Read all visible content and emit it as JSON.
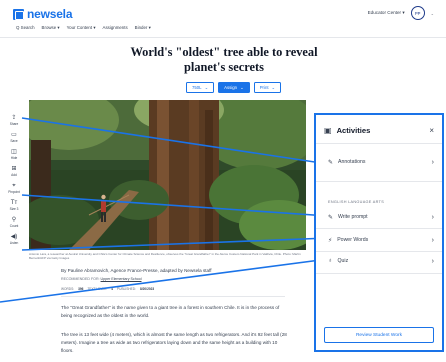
{
  "header": {
    "logo": "newsela",
    "nav": [
      "Q Search",
      "Browse ▾",
      "Your Content ▾",
      "Assignments",
      "Binder ▾"
    ],
    "user": {
      "label": "Educator Center ▾",
      "avatar_initials": "PP"
    }
  },
  "article": {
    "title": "World's \"oldest\" tree able to reveal planet's secrets",
    "controls": {
      "lexile": "750L",
      "assign": "Assign",
      "print": "Print"
    },
    "caption": "Antonio Lara, a researcher at Austral University and Chile's Center for Climate Science and Resilience, observes the \"Great Grandfather\" in the Alerce Costero National Park in Valdivia, Chile. Photo: Martin Bernetti/AFP via Getty Images",
    "byline": "By Pauline Abramovich, Agence France-Presse, adapted by Newsela staff",
    "byline2_prefix": "RECOMMENDED FOR:",
    "byline2_value": "Upper Elementary School",
    "meta": {
      "words_label": "WORDS:",
      "words": "396",
      "text_level_label": "TEXT LEVEL:",
      "text_level": "4",
      "published_label": "PUBLISHED:",
      "published": "8/20/2023"
    },
    "paragraphs": [
      "The \"Great Grandfather\" is the name given to a giant tree in a forest in southern Chile. It is in the process of being recognized as the oldest in the world.",
      "The tree is 13 feet wide (4 meters), which is almost the same length as two refrigerators. And it's 92 feet tall (28 meters). Imagine a tree as wide as two refrigerators laying down and the same height as a building with 10 floors."
    ]
  },
  "toolbar": [
    {
      "icon": "share-icon",
      "glyph": "⇪",
      "label": "Share"
    },
    {
      "icon": "save-icon",
      "glyph": "▭",
      "label": "Save"
    },
    {
      "icon": "hide-icon",
      "glyph": "◫",
      "label": "Hide"
    },
    {
      "icon": "add-icon",
      "glyph": "⊞",
      "label": "Add"
    },
    {
      "icon": "pinpoint-icon",
      "glyph": "⌖",
      "label": "Pinpoint"
    },
    {
      "icon": "text-size-icon",
      "glyph": "Tт",
      "label": "Size 3"
    },
    {
      "icon": "count-icon",
      "glyph": "⚲",
      "label": "Count"
    },
    {
      "icon": "listen-icon",
      "glyph": "◀)",
      "label": "Listen"
    }
  ],
  "activities": {
    "title": "Activities",
    "close": "×",
    "section_label": "ENGLISH LANGUAGE ARTS",
    "items": [
      {
        "label": "Annotations",
        "icon": "pencil-icon",
        "glyph": "✎"
      },
      {
        "label": "Write prompt",
        "icon": "pencil-icon",
        "glyph": "✎"
      },
      {
        "label": "Power Words",
        "icon": "bolt-icon",
        "glyph": "⚡"
      },
      {
        "label": "Quiz",
        "icon": "lightbulb-icon",
        "glyph": "♁"
      }
    ],
    "review_button": "Review Student Work"
  },
  "colors": {
    "brand": "#1a73e8",
    "text": "#1f2937",
    "muted": "#6b7280"
  }
}
